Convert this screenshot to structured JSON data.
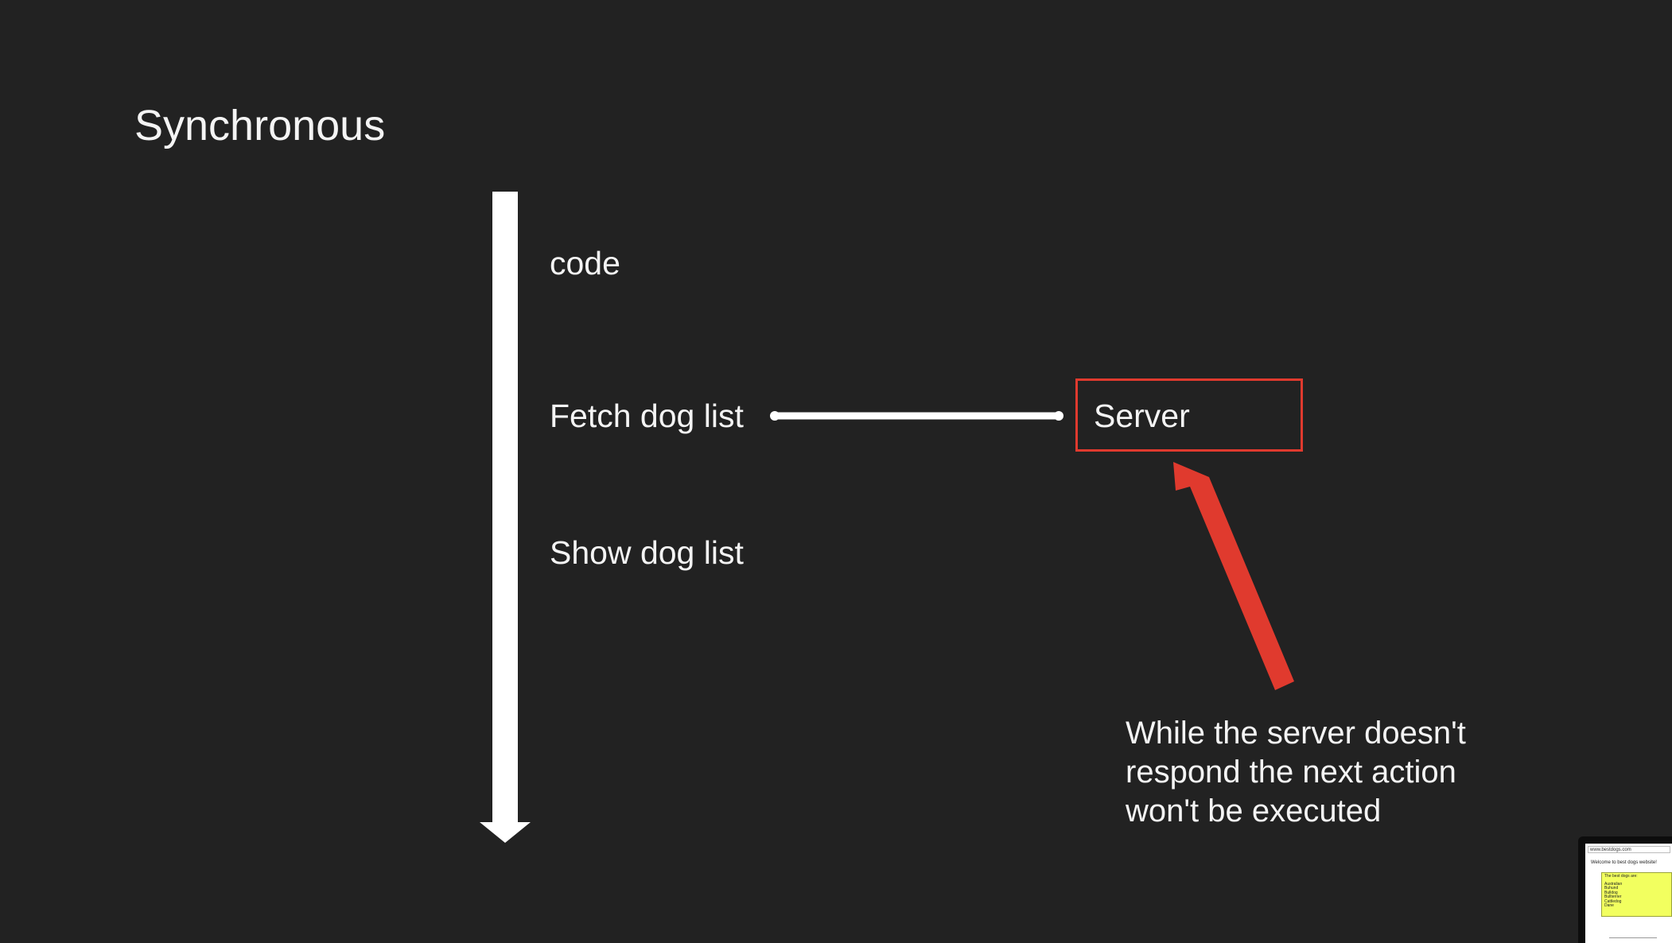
{
  "slide": {
    "title": "Synchronous",
    "background_color": "#222222",
    "accent_color": "#e03a2e"
  },
  "flow": {
    "steps": [
      {
        "id": "code",
        "label": "code"
      },
      {
        "id": "fetch",
        "label": "Fetch dog list"
      },
      {
        "id": "show",
        "label": "Show dog list"
      }
    ]
  },
  "server": {
    "label": "Server"
  },
  "note": {
    "lines": [
      "While the server doesn't",
      "respond the next action",
      "won't be executed"
    ]
  },
  "thumbnail": {
    "url": "www.bestdogs.com",
    "welcome": "Welcome to best dogs website!",
    "card_title": "The best dogs are:",
    "items": [
      "Australian",
      "Buhund",
      "Bulldog",
      "Bullterrier",
      "Cattledog",
      "Dane"
    ]
  }
}
